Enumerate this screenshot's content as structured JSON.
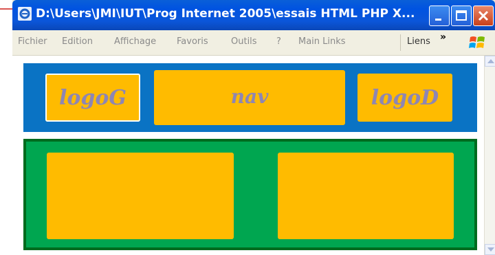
{
  "window": {
    "title": "D:\\Users\\JMI\\IUT\\Prog Internet 2005\\essais HTML PHP X..."
  },
  "menu": {
    "items": [
      "Fichier",
      "Edition",
      "Affichage",
      "Favoris",
      "Outils",
      "?",
      "Main Links"
    ],
    "links_label": "Liens",
    "chevron": "»"
  },
  "page": {
    "logo_left": "logoG",
    "nav": "nav",
    "logo_right": "logoD"
  },
  "colors": {
    "banner_blue": "#0a73c4",
    "box_orange": "#ffbb00",
    "panel_green": "#00a650",
    "label_purple": "#8e86b3"
  }
}
